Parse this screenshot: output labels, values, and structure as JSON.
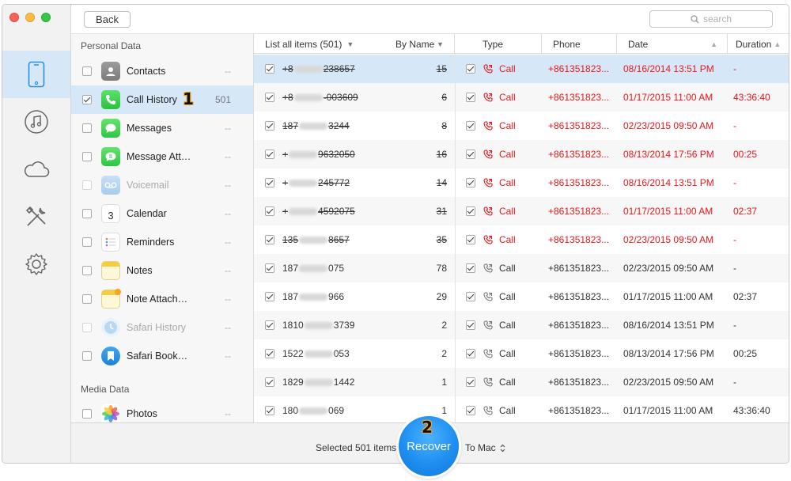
{
  "window": {
    "back_label": "Back",
    "search_placeholder": "search"
  },
  "nav": {
    "items": [
      {
        "name": "device-icon",
        "active": true
      },
      {
        "name": "music-icon",
        "active": false
      },
      {
        "name": "cloud-icon",
        "active": false
      },
      {
        "name": "tools-icon",
        "active": false
      },
      {
        "name": "settings-icon",
        "active": false
      }
    ]
  },
  "categories": {
    "personal_heading": "Personal Data",
    "media_heading": "Media Data",
    "items": [
      {
        "label": "Contacts",
        "count": "--",
        "icon": "contacts-icon",
        "checked": false,
        "disabled": false
      },
      {
        "label": "Call History",
        "count": "501",
        "icon": "phone-icon",
        "checked": true,
        "disabled": false,
        "active": true
      },
      {
        "label": "Messages",
        "count": "--",
        "icon": "messages-icon",
        "checked": false,
        "disabled": false
      },
      {
        "label": "Message Att…",
        "count": "--",
        "icon": "message-attachment-icon",
        "checked": false,
        "disabled": false
      },
      {
        "label": "Voicemail",
        "count": "--",
        "icon": "voicemail-icon",
        "checked": false,
        "disabled": true
      },
      {
        "label": "Calendar",
        "count": "--",
        "icon": "calendar-icon",
        "checked": false,
        "disabled": false,
        "calendar_day": "3"
      },
      {
        "label": "Reminders",
        "count": "--",
        "icon": "reminders-icon",
        "checked": false,
        "disabled": false
      },
      {
        "label": "Notes",
        "count": "--",
        "icon": "notes-icon",
        "checked": false,
        "disabled": false
      },
      {
        "label": "Note Attach…",
        "count": "--",
        "icon": "note-attachment-icon",
        "checked": false,
        "disabled": false
      },
      {
        "label": "Safari History",
        "count": "--",
        "icon": "safari-history-icon",
        "checked": false,
        "disabled": true
      },
      {
        "label": "Safari Book…",
        "count": "--",
        "icon": "safari-bookmarks-icon",
        "checked": false,
        "disabled": false
      }
    ],
    "media_items": [
      {
        "label": "Photos",
        "count": "--",
        "icon": "photos-icon",
        "checked": false,
        "disabled": false
      }
    ]
  },
  "annotations": {
    "step1": "1",
    "step2": "2"
  },
  "table": {
    "headers": {
      "list": "List all items (501)",
      "sort": "By Name",
      "type": "Type",
      "phone": "Phone",
      "date": "Date",
      "duration": "Duration"
    },
    "rows": [
      {
        "name_pre": "+8",
        "name_post": "238657",
        "count": "15",
        "deleted": true,
        "type": "Call",
        "phone": "+861351823...",
        "date": "08/16/2014 13:51 PM",
        "duration": "-"
      },
      {
        "name_pre": "+8",
        "name_post": "-003609",
        "count": "6",
        "deleted": true,
        "type": "Call",
        "phone": "+861351823...",
        "date": "01/17/2015 11:00 AM",
        "duration": "43:36:40"
      },
      {
        "name_pre": "187",
        "name_post": "3244",
        "count": "8",
        "deleted": true,
        "type": "Call",
        "phone": "+861351823...",
        "date": "02/23/2015 09:50 AM",
        "duration": "-"
      },
      {
        "name_pre": "+",
        "name_post": "9632050",
        "count": "16",
        "deleted": true,
        "type": "Call",
        "phone": "+861351823...",
        "date": "08/13/2014 17:56 PM",
        "duration": "00:25"
      },
      {
        "name_pre": "+",
        "name_post": "245772",
        "count": "14",
        "deleted": true,
        "type": "Call",
        "phone": "+861351823...",
        "date": "08/16/2014 13:51 PM",
        "duration": "-"
      },
      {
        "name_pre": "+",
        "name_post": "4592075",
        "count": "31",
        "deleted": true,
        "type": "Call",
        "phone": "+861351823...",
        "date": "01/17/2015 11:00 AM",
        "duration": "02:37"
      },
      {
        "name_pre": "135",
        "name_post": "8657",
        "count": "35",
        "deleted": true,
        "type": "Call",
        "phone": "+861351823...",
        "date": "02/23/2015 09:50 AM",
        "duration": "-"
      },
      {
        "name_pre": "187",
        "name_post": "075",
        "count": "78",
        "deleted": false,
        "type": "Call",
        "phone": "+861351823...",
        "date": "02/23/2015 09:50 AM",
        "duration": "-"
      },
      {
        "name_pre": "187",
        "name_post": "966",
        "count": "29",
        "deleted": false,
        "type": "Call",
        "phone": "+861351823...",
        "date": "01/17/2015 11:00 AM",
        "duration": "02:37"
      },
      {
        "name_pre": "1810",
        "name_post": "3739",
        "count": "2",
        "deleted": false,
        "type": "Call",
        "phone": "+861351823...",
        "date": "08/16/2014 13:51 PM",
        "duration": "-"
      },
      {
        "name_pre": "1522",
        "name_post": "053",
        "count": "2",
        "deleted": false,
        "type": "Call",
        "phone": "+861351823...",
        "date": "08/13/2014 17:56 PM",
        "duration": "00:25"
      },
      {
        "name_pre": "1829",
        "name_post": "1442",
        "count": "1",
        "deleted": false,
        "type": "Call",
        "phone": "+861351823...",
        "date": "02/23/2015 09:50 AM",
        "duration": "-"
      },
      {
        "name_pre": "180",
        "name_post": "069",
        "count": "1",
        "deleted": false,
        "type": "Call",
        "phone": "+861351823...",
        "date": "01/17/2015 11:00 AM",
        "duration": "43:36:40"
      }
    ]
  },
  "footer": {
    "selected_text": "Selected 501 items",
    "recover_label": "Recover",
    "destination": "To Mac"
  },
  "colors": {
    "deleted": "#e8161b",
    "accent": "#1d8ef0",
    "selection": "#d6e8f8"
  }
}
